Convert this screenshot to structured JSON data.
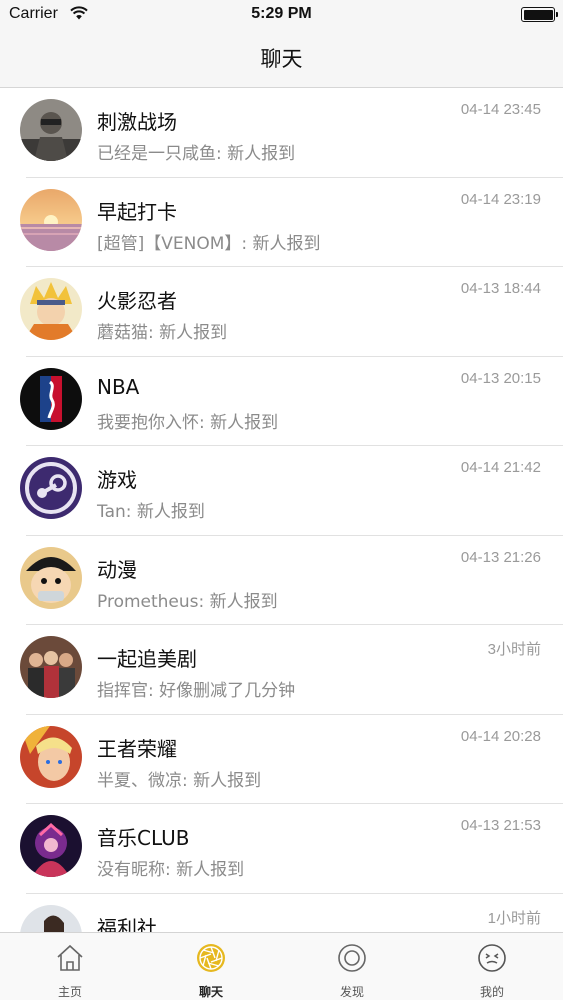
{
  "status_bar": {
    "carrier": "Carrier",
    "time": "5:29 PM"
  },
  "nav": {
    "title": "聊天"
  },
  "chats": [
    {
      "name": "刺激战场",
      "message": "已经是一只咸鱼: 新人报到",
      "time": "04-14 23:45",
      "avatar": "soldier"
    },
    {
      "name": "早起打卡",
      "message": "[超管]【VENOM】: 新人报到",
      "time": "04-14 23:19",
      "avatar": "sunrise"
    },
    {
      "name": "火影忍者",
      "message": "蘑菇猫: 新人报到",
      "time": "04-13 18:44",
      "avatar": "naruto"
    },
    {
      "name": "NBA",
      "message": "我要抱你入怀: 新人报到",
      "time": "04-13 20:15",
      "avatar": "nba-logo"
    },
    {
      "name": "游戏",
      "message": "Tan: 新人报到",
      "time": "04-14 21:42",
      "avatar": "steam-logo"
    },
    {
      "name": "动漫",
      "message": "Prometheus: 新人报到",
      "time": "04-13 21:26",
      "avatar": "luffy"
    },
    {
      "name": "一起追美剧",
      "message": "指挥官: 好像删减了几分钟",
      "time": "3小时前",
      "avatar": "group-photo"
    },
    {
      "name": "王者荣耀",
      "message": "半夏、微凉: 新人报到",
      "time": "04-14 20:28",
      "avatar": "hero"
    },
    {
      "name": "音乐CLUB",
      "message": "没有昵称: 新人报到",
      "time": "04-13 21:53",
      "avatar": "music"
    },
    {
      "name": "福利社",
      "message": "",
      "time": "1小时前",
      "avatar": "girl"
    }
  ],
  "tabbar": {
    "items": [
      {
        "label": "主页",
        "icon": "home-icon"
      },
      {
        "label": "聊天",
        "icon": "chat-aperture-icon",
        "active": true
      },
      {
        "label": "发现",
        "icon": "discover-icon"
      },
      {
        "label": "我的",
        "icon": "profile-face-icon"
      }
    ]
  },
  "colors": {
    "accent": "#e6b820",
    "separator": "#e1e1e1",
    "secondary_text": "#8b8b8b"
  }
}
